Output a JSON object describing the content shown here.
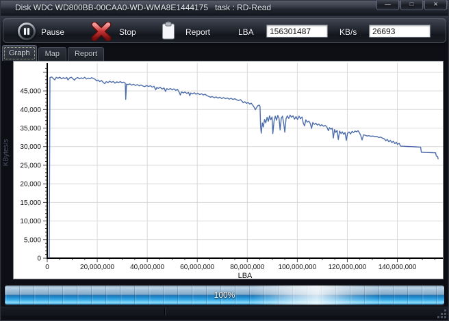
{
  "window": {
    "title": "Disk WDC WD800BB-00CAA0-WD-WMA8E1444175   task : RD-Read",
    "controls": [
      {
        "name": "minimize",
        "glyph": "—"
      },
      {
        "name": "maximize",
        "glyph": "□"
      },
      {
        "name": "close",
        "glyph": "✕"
      }
    ]
  },
  "toolbar": {
    "pause_label": "Pause",
    "stop_label": "Stop",
    "report_label": "Report",
    "lba_label": "LBA",
    "lba_value": "156301487",
    "kbs_label": "KB/s",
    "kbs_value": "26693"
  },
  "tabs": [
    {
      "label": "Graph",
      "active": true
    },
    {
      "label": "Map",
      "active": false
    },
    {
      "label": "Report",
      "active": false
    }
  ],
  "progress": {
    "label": "100%",
    "percent": 100
  },
  "colors": {
    "series_line": "#4c6cab",
    "grid": "#d9d9d9",
    "axis": "#000000",
    "tick": "#444444",
    "tick_text": "#111111",
    "plot_bg": "#ffffff",
    "progress_blue": "#1d88cc"
  },
  "chart_data": {
    "type": "line",
    "title": "",
    "xlabel": "LBA",
    "ylabel": "KBytes/s",
    "xlim": [
      0,
      158200000
    ],
    "ylim": [
      0,
      52000
    ],
    "grid": true,
    "legend": "none",
    "x_ticks": [
      0,
      20000000,
      40000000,
      60000000,
      80000000,
      100000000,
      120000000,
      140000000
    ],
    "x_tick_labels": [
      "0",
      "20,000,000",
      "40,000,000",
      "60,000,000",
      "80,000,000",
      "100,000,000",
      "120,000,000",
      "140,000,000"
    ],
    "x_minor_step": 5000000,
    "y_ticks": [
      0,
      5000,
      10000,
      15000,
      20000,
      25000,
      30000,
      35000,
      40000,
      45000
    ],
    "y_tick_labels": [
      "0",
      "5,000",
      "10,000",
      "15,000",
      "20,000",
      "25,000",
      "30,000",
      "35,000",
      "40,000",
      "45,000"
    ],
    "y_grid_step": 5000,
    "y_grid_max": 50000,
    "y_minor_step": 1000,
    "series": [
      {
        "name": "read-speed-kbytes-per-sec",
        "points": [
          [
            800000,
            200
          ],
          [
            1100000,
            48600
          ],
          [
            1800000,
            48750
          ],
          [
            2500000,
            48300
          ],
          [
            3000000,
            47950
          ],
          [
            3600000,
            48650
          ],
          [
            4300000,
            48400
          ],
          [
            5000000,
            48700
          ],
          [
            5700000,
            48250
          ],
          [
            6400000,
            48550
          ],
          [
            7100000,
            48350
          ],
          [
            7800000,
            48600
          ],
          [
            8300000,
            47950
          ],
          [
            9000000,
            48500
          ],
          [
            9700000,
            48650
          ],
          [
            10400000,
            48200
          ],
          [
            10900000,
            47900
          ],
          [
            11500000,
            48400
          ],
          [
            12200000,
            48600
          ],
          [
            12900000,
            48250
          ],
          [
            13600000,
            48500
          ],
          [
            14300000,
            48350
          ],
          [
            15000000,
            48650
          ],
          [
            15700000,
            48200
          ],
          [
            16400000,
            48450
          ],
          [
            17100000,
            48300
          ],
          [
            17800000,
            48550
          ],
          [
            18500000,
            48350
          ],
          [
            19200000,
            48100
          ],
          [
            19800000,
            47700
          ],
          [
            20400000,
            47900
          ],
          [
            21000000,
            47500
          ],
          [
            21700000,
            47800
          ],
          [
            22400000,
            47300
          ],
          [
            23000000,
            46950
          ],
          [
            23600000,
            47500
          ],
          [
            24300000,
            47250
          ],
          [
            25000000,
            47600
          ],
          [
            25700000,
            47300
          ],
          [
            26400000,
            47550
          ],
          [
            27100000,
            47100
          ],
          [
            27800000,
            47450
          ],
          [
            28500000,
            47250
          ],
          [
            29200000,
            47500
          ],
          [
            29900000,
            47200
          ],
          [
            30600000,
            47350
          ],
          [
            31200000,
            47100
          ],
          [
            31400000,
            42700
          ],
          [
            31700000,
            46800
          ],
          [
            32300000,
            46700
          ],
          [
            33000000,
            46900
          ],
          [
            33800000,
            46550
          ],
          [
            34500000,
            46800
          ],
          [
            35300000,
            46450
          ],
          [
            36000000,
            46700
          ],
          [
            36800000,
            46350
          ],
          [
            37500000,
            46600
          ],
          [
            38300000,
            46300
          ],
          [
            39000000,
            46150
          ],
          [
            39800000,
            46450
          ],
          [
            40500000,
            46200
          ],
          [
            41300000,
            46400
          ],
          [
            42000000,
            46000
          ],
          [
            42700000,
            46250
          ],
          [
            43400000,
            45300
          ],
          [
            43800000,
            45900
          ],
          [
            44500000,
            45700
          ],
          [
            45200000,
            45950
          ],
          [
            46000000,
            45500
          ],
          [
            46700000,
            45800
          ],
          [
            47300000,
            44850
          ],
          [
            47800000,
            45600
          ],
          [
            48500000,
            45350
          ],
          [
            49200000,
            45650
          ],
          [
            50000000,
            45300
          ],
          [
            50700000,
            45550
          ],
          [
            51400000,
            45150
          ],
          [
            52100000,
            45400
          ],
          [
            52800000,
            44600
          ],
          [
            53200000,
            43900
          ],
          [
            53700000,
            44750
          ],
          [
            54400000,
            44450
          ],
          [
            55100000,
            44700
          ],
          [
            55800000,
            44300
          ],
          [
            56500000,
            44600
          ],
          [
            57000000,
            43700
          ],
          [
            57400000,
            44450
          ],
          [
            58100000,
            44200
          ],
          [
            58800000,
            44500
          ],
          [
            59500000,
            44100
          ],
          [
            60200000,
            44400
          ],
          [
            61000000,
            44000
          ],
          [
            61700000,
            44250
          ],
          [
            62400000,
            43900
          ],
          [
            63100000,
            44100
          ],
          [
            63800000,
            43750
          ],
          [
            64500000,
            43550
          ],
          [
            65300000,
            43300
          ],
          [
            66000000,
            43500
          ],
          [
            66800000,
            43150
          ],
          [
            67500000,
            43400
          ],
          [
            68300000,
            43050
          ],
          [
            69000000,
            43300
          ],
          [
            69800000,
            42950
          ],
          [
            70500000,
            43200
          ],
          [
            71300000,
            42900
          ],
          [
            72000000,
            43100
          ],
          [
            72800000,
            42800
          ],
          [
            73500000,
            43000
          ],
          [
            74300000,
            42700
          ],
          [
            75000000,
            42900
          ],
          [
            75800000,
            42600
          ],
          [
            76500000,
            42400
          ],
          [
            77300000,
            42650
          ],
          [
            78000000,
            42150
          ],
          [
            78400000,
            41800
          ],
          [
            79000000,
            42100
          ],
          [
            79700000,
            41650
          ],
          [
            80300000,
            41900
          ],
          [
            81000000,
            41450
          ],
          [
            81600000,
            41700
          ],
          [
            82200000,
            41150
          ],
          [
            82700000,
            40650
          ],
          [
            83200000,
            39950
          ],
          [
            83700000,
            40500
          ],
          [
            84300000,
            41050
          ],
          [
            84800000,
            41150
          ],
          [
            85100000,
            40800
          ],
          [
            85300000,
            35400
          ],
          [
            85600000,
            33600
          ],
          [
            86000000,
            36400
          ],
          [
            86400000,
            35300
          ],
          [
            86900000,
            37300
          ],
          [
            87400000,
            36400
          ],
          [
            87900000,
            37900
          ],
          [
            88400000,
            36800
          ],
          [
            88900000,
            38300
          ],
          [
            89400000,
            37200
          ],
          [
            89900000,
            38000
          ],
          [
            90200000,
            33500
          ],
          [
            90700000,
            36900
          ],
          [
            91200000,
            38200
          ],
          [
            91700000,
            37100
          ],
          [
            92200000,
            38400
          ],
          [
            92700000,
            37600
          ],
          [
            93100000,
            34500
          ],
          [
            93600000,
            37700
          ],
          [
            94100000,
            38200
          ],
          [
            94600000,
            36100
          ],
          [
            95000000,
            33900
          ],
          [
            95500000,
            37500
          ],
          [
            96000000,
            38300
          ],
          [
            96600000,
            37600
          ],
          [
            97100000,
            38500
          ],
          [
            97700000,
            37900
          ],
          [
            98300000,
            38300
          ],
          [
            98900000,
            37400
          ],
          [
            99500000,
            38100
          ],
          [
            100100000,
            37300
          ],
          [
            100700000,
            38200
          ],
          [
            101300000,
            37500
          ],
          [
            101900000,
            38000
          ],
          [
            102400000,
            36300
          ],
          [
            102900000,
            35600
          ],
          [
            103400000,
            37200
          ],
          [
            104000000,
            36600
          ],
          [
            104600000,
            36900
          ],
          [
            105200000,
            36200
          ],
          [
            105700000,
            34900
          ],
          [
            106200000,
            36500
          ],
          [
            106800000,
            36000
          ],
          [
            107400000,
            36300
          ],
          [
            108000000,
            35800
          ],
          [
            108600000,
            36100
          ],
          [
            109200000,
            35600
          ],
          [
            109800000,
            35900
          ],
          [
            110500000,
            35500
          ],
          [
            111200000,
            35700
          ],
          [
            111900000,
            35200
          ],
          [
            112400000,
            34300
          ],
          [
            112900000,
            35100
          ],
          [
            113500000,
            34700
          ],
          [
            114000000,
            35000
          ],
          [
            114400000,
            32300
          ],
          [
            114900000,
            34600
          ],
          [
            115400000,
            33800
          ],
          [
            115900000,
            34400
          ],
          [
            116400000,
            31900
          ],
          [
            116900000,
            34200
          ],
          [
            117500000,
            33500
          ],
          [
            118000000,
            34000
          ],
          [
            118600000,
            33300
          ],
          [
            119100000,
            33800
          ],
          [
            119600000,
            31700
          ],
          [
            120100000,
            33600
          ],
          [
            120700000,
            33950
          ],
          [
            121300000,
            33400
          ],
          [
            121900000,
            34100
          ],
          [
            122500000,
            33800
          ],
          [
            123100000,
            34200
          ],
          [
            123700000,
            34000
          ],
          [
            124300000,
            34300
          ],
          [
            124900000,
            33700
          ],
          [
            125400000,
            32900
          ],
          [
            125900000,
            31800
          ],
          [
            126500000,
            33200
          ],
          [
            127200000,
            33050
          ],
          [
            127900000,
            32850
          ],
          [
            128600000,
            32950
          ],
          [
            129400000,
            32800
          ],
          [
            130200000,
            32850
          ],
          [
            131000000,
            32700
          ],
          [
            131800000,
            32750
          ],
          [
            132600000,
            32450
          ],
          [
            133300000,
            32600
          ],
          [
            134000000,
            32300
          ],
          [
            134800000,
            32100
          ],
          [
            135400000,
            31600
          ],
          [
            136000000,
            31950
          ],
          [
            136600000,
            31300
          ],
          [
            137200000,
            31700
          ],
          [
            137800000,
            31100
          ],
          [
            138400000,
            31450
          ],
          [
            139000000,
            30800
          ],
          [
            139600000,
            31200
          ],
          [
            140100000,
            30600
          ],
          [
            140700000,
            30950
          ],
          [
            141300000,
            30150
          ],
          [
            142500000,
            30100
          ],
          [
            144000000,
            30050
          ],
          [
            145500000,
            30000
          ],
          [
            147000000,
            29950
          ],
          [
            148500000,
            29900
          ],
          [
            149300000,
            29880
          ],
          [
            149600000,
            28500
          ],
          [
            151000000,
            28450
          ],
          [
            152500000,
            28420
          ],
          [
            154000000,
            28380
          ],
          [
            155300000,
            28350
          ],
          [
            155600000,
            27450
          ],
          [
            156100000,
            27400
          ],
          [
            156301487,
            26693
          ]
        ]
      }
    ]
  }
}
